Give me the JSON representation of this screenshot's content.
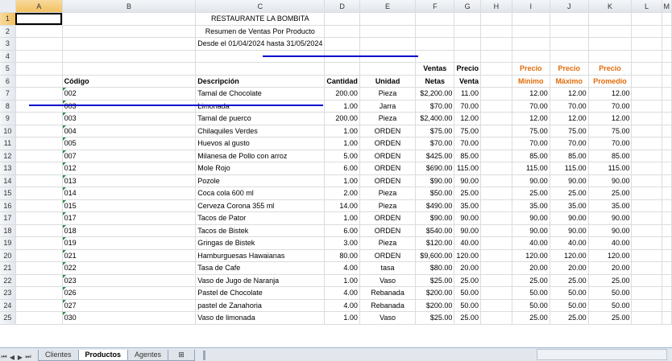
{
  "columns": [
    "A",
    "B",
    "C",
    "D",
    "E",
    "F",
    "G",
    "H",
    "I",
    "J",
    "K",
    "L",
    "M"
  ],
  "selected_column": "A",
  "selected_row": 1,
  "rows": [
    {
      "n": 1,
      "cells": {
        "C": "RESTAURANTE LA BOMBITA"
      }
    },
    {
      "n": 2,
      "cells": {
        "C": "Resumen de Ventas Por Producto"
      }
    },
    {
      "n": 3,
      "cells": {
        "C": "Desde el 01/04/2024 hasta 31/05/2024"
      }
    },
    {
      "n": 4,
      "cells": {}
    },
    {
      "n": 5,
      "cells": {
        "F": "Ventas",
        "G": "Precio",
        "I": "Precio",
        "J": "Precio",
        "K": "Precio"
      }
    },
    {
      "n": 6,
      "cells": {
        "B": "Código",
        "C": "Descripción",
        "D": "Cantidad",
        "E": "Unidad",
        "F": "Netas",
        "G": "Venta",
        "I": "Mínimo",
        "J": "Máximo",
        "K": "Promedio"
      }
    },
    {
      "n": 7,
      "cells": {
        "B": "002",
        "C": "Tamal de Chocolate",
        "D": "200.00",
        "E": "Pieza",
        "F": "$2,200.00",
        "G": "11.00",
        "I": "12.00",
        "J": "12.00",
        "K": "12.00"
      }
    },
    {
      "n": 8,
      "cells": {
        "B": "003",
        "C": "Limonada",
        "D": "1.00",
        "E": "Jarra",
        "F": "$70.00",
        "G": "70.00",
        "I": "70.00",
        "J": "70.00",
        "K": "70.00"
      }
    },
    {
      "n": 9,
      "cells": {
        "B": "003",
        "C": "Tamal de puerco",
        "D": "200.00",
        "E": "Pieza",
        "F": "$2,400.00",
        "G": "12.00",
        "I": "12.00",
        "J": "12.00",
        "K": "12.00"
      }
    },
    {
      "n": 10,
      "cells": {
        "B": "004",
        "C": "Chilaquiles Verdes",
        "D": "1.00",
        "E": "ORDEN",
        "F": "$75.00",
        "G": "75.00",
        "I": "75.00",
        "J": "75.00",
        "K": "75.00"
      }
    },
    {
      "n": 11,
      "cells": {
        "B": "005",
        "C": "Huevos al gusto",
        "D": "1.00",
        "E": "ORDEN",
        "F": "$70.00",
        "G": "70.00",
        "I": "70.00",
        "J": "70.00",
        "K": "70.00"
      }
    },
    {
      "n": 12,
      "cells": {
        "B": "007",
        "C": "Milanesa de Pollo con arroz",
        "D": "5.00",
        "E": "ORDEN",
        "F": "$425.00",
        "G": "85.00",
        "I": "85.00",
        "J": "85.00",
        "K": "85.00"
      }
    },
    {
      "n": 13,
      "cells": {
        "B": "012",
        "C": "Mole Rojo",
        "D": "6.00",
        "E": "ORDEN",
        "F": "$690.00",
        "G": "115.00",
        "I": "115.00",
        "J": "115.00",
        "K": "115.00"
      }
    },
    {
      "n": 14,
      "cells": {
        "B": "013",
        "C": "Pozole",
        "D": "1.00",
        "E": "ORDEN",
        "F": "$90.00",
        "G": "90.00",
        "I": "90.00",
        "J": "90.00",
        "K": "90.00"
      }
    },
    {
      "n": 15,
      "cells": {
        "B": "014",
        "C": "Coca cola 600 ml",
        "D": "2.00",
        "E": "Pieza",
        "F": "$50.00",
        "G": "25.00",
        "I": "25.00",
        "J": "25.00",
        "K": "25.00"
      }
    },
    {
      "n": 16,
      "cells": {
        "B": "015",
        "C": "Cerveza Corona 355 ml",
        "D": "14.00",
        "E": "Pieza",
        "F": "$490.00",
        "G": "35.00",
        "I": "35.00",
        "J": "35.00",
        "K": "35.00"
      }
    },
    {
      "n": 17,
      "cells": {
        "B": "017",
        "C": "Tacos de Pator",
        "D": "1.00",
        "E": "ORDEN",
        "F": "$90.00",
        "G": "90.00",
        "I": "90.00",
        "J": "90.00",
        "K": "90.00"
      }
    },
    {
      "n": 18,
      "cells": {
        "B": "018",
        "C": "Tacos de Bistek",
        "D": "6.00",
        "E": "ORDEN",
        "F": "$540.00",
        "G": "90.00",
        "I": "90.00",
        "J": "90.00",
        "K": "90.00"
      }
    },
    {
      "n": 19,
      "cells": {
        "B": "019",
        "C": "Gringas de Bistek",
        "D": "3.00",
        "E": "Pieza",
        "F": "$120.00",
        "G": "40.00",
        "I": "40.00",
        "J": "40.00",
        "K": "40.00"
      }
    },
    {
      "n": 20,
      "cells": {
        "B": "021",
        "C": "Hamburguesas Hawaianas",
        "D": "80.00",
        "E": "ORDEN",
        "F": "$9,600.00",
        "G": "120.00",
        "I": "120.00",
        "J": "120.00",
        "K": "120.00"
      }
    },
    {
      "n": 21,
      "cells": {
        "B": "022",
        "C": "Tasa de Cafe",
        "D": "4.00",
        "E": "tasa",
        "F": "$80.00",
        "G": "20.00",
        "I": "20.00",
        "J": "20.00",
        "K": "20.00"
      }
    },
    {
      "n": 22,
      "cells": {
        "B": "023",
        "C": "Vaso de Jugo de Naranja",
        "D": "1.00",
        "E": "Vaso",
        "F": "$25.00",
        "G": "25.00",
        "I": "25.00",
        "J": "25.00",
        "K": "25.00"
      }
    },
    {
      "n": 23,
      "cells": {
        "B": "026",
        "C": "Pastel de Chocolate",
        "D": "4.00",
        "E": "Rebanada",
        "F": "$200.00",
        "G": "50.00",
        "I": "50.00",
        "J": "50.00",
        "K": "50.00"
      }
    },
    {
      "n": 24,
      "cells": {
        "B": "027",
        "C": "pastel de Zanahoria",
        "D": "4.00",
        "E": "Rebanada",
        "F": "$200.00",
        "G": "50.00",
        "I": "50.00",
        "J": "50.00",
        "K": "50.00"
      }
    },
    {
      "n": 25,
      "cells": {
        "B": "030",
        "C": "Vaso de limonada",
        "D": "1.00",
        "E": "Vaso",
        "F": "$25.00",
        "G": "25.00",
        "I": "25.00",
        "J": "25.00",
        "K": "25.00"
      }
    }
  ],
  "sheet_tabs": [
    {
      "label": "Clientes",
      "active": false
    },
    {
      "label": "Productos",
      "active": true
    },
    {
      "label": "Agentes",
      "active": false
    }
  ],
  "colors": {
    "orange_header": "#e26b0a",
    "underline_blue": "#0000cc",
    "flag_green": "#1e8e3e"
  }
}
